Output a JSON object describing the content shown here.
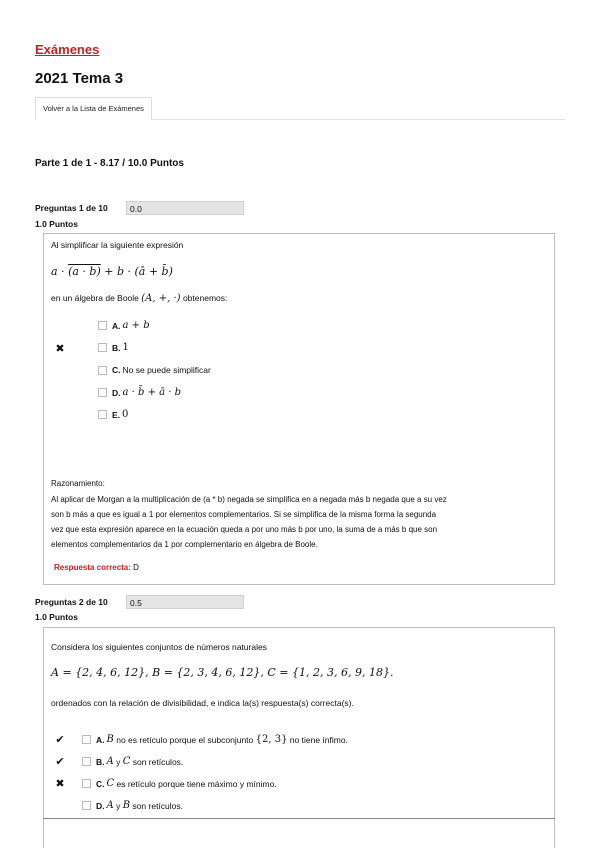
{
  "breadcrumb": "Exámenes",
  "exam_title": "2021 Tema 3",
  "back_button": "Volver a la Lista de Exámenes",
  "part_header": "Parte 1 de 1 - 8.17 / 10.0 Puntos",
  "q1": {
    "header": "Preguntas 1 de 10",
    "score": "0.0",
    "points": "1.0 Puntos",
    "intro": "Al simplificar la siguiente expresión",
    "expr_a": "a · ",
    "expr_bar": "(a · b)",
    "expr_b": " + b · (ā + b̄)",
    "algebra_prefix": "en un álgebra de Boole ",
    "algebra_math": "(A, +, ·)",
    "algebra_suffix": " obtenemos:",
    "options": [
      {
        "letter": "A.",
        "text": "a + b",
        "math": true,
        "mark": ""
      },
      {
        "letter": "B.",
        "text": "1",
        "math": true,
        "mark": "✖"
      },
      {
        "letter": "C.",
        "text": "No se puede simplificar",
        "math": false,
        "mark": ""
      },
      {
        "letter": "D.",
        "text": "a · b̄ + ā · b",
        "math": true,
        "mark": ""
      },
      {
        "letter": "E.",
        "text": "0",
        "math": true,
        "mark": ""
      }
    ],
    "reason_title": "Razonamiento:",
    "reason_lines": [
      "Al aplicar de Morgan a la multiplicación de (a * b) negada se simplifica en a negada más b negada que a su vez",
      "son b más a que es igual a 1 por elementos complementarios. Si se simplifica de la misma forma la segunda",
      "vez que esta expresión aparece en la ecuación queda a por uno más b por uno, la suma de a más b que son",
      "elementos complementarios da 1 por complementario en álgebra de Boole."
    ],
    "correct_label": "Respuesta correcta:",
    "correct_value": " D"
  },
  "q2": {
    "header": "Preguntas 2 de 10",
    "score": "0.5",
    "points": "1.0 Puntos",
    "intro": "Considera los siguientes conjuntos de números naturales",
    "sets": "A = {2, 4, 6, 12},   B = {2, 3, 4, 6, 12},   C = {1, 2, 3, 6, 9, 18}.",
    "order_text": "ordenados con la relación de divisibilidad, e indica la(s) respuesta(s) correcta(s).",
    "options": [
      {
        "letter": "A.",
        "m1": "B",
        "t1": " no es retículo porque el subconjunto ",
        "m2": "{2, 3}",
        "t2": " no tiene ínfimo.",
        "mark": "✔"
      },
      {
        "letter": "B.",
        "m1": "A",
        "t1": " y ",
        "m2": "C",
        "t2": " son retículos.",
        "mark": "✔"
      },
      {
        "letter": "C.",
        "m1": "C",
        "t1": " es retículo porque tiene máximo y mínimo.",
        "m2": "",
        "t2": "",
        "mark": "✖"
      },
      {
        "letter": "D.",
        "m1": "A",
        "t1": " y ",
        "m2": "B",
        "t2": " son retículos.",
        "mark": ""
      }
    ]
  }
}
